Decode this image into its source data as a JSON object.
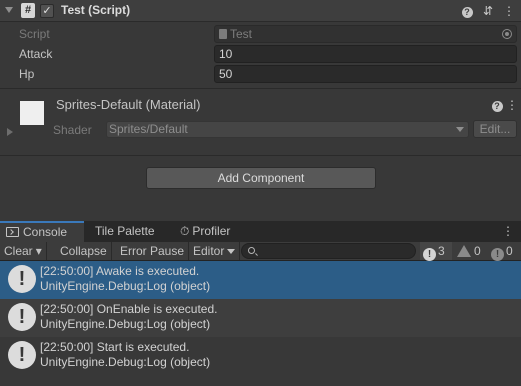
{
  "inspector": {
    "component": {
      "title": "Test (Script)",
      "script_icon_glyph": "#",
      "enabled_glyph": "✓",
      "icons": [
        "help-icon",
        "preset-icon",
        "more-icon"
      ]
    },
    "properties": [
      {
        "label": "Script",
        "value": "Test",
        "disabled": true
      },
      {
        "label": "Attack",
        "value": "10",
        "disabled": false
      },
      {
        "label": "Hp",
        "value": "50",
        "disabled": false
      }
    ],
    "material": {
      "title": "Sprites-Default (Material)",
      "shader_label": "Shader",
      "shader_value": "Sprites/Default",
      "edit_label": "Edit..."
    },
    "add_component_label": "Add Component"
  },
  "console": {
    "tabs": [
      {
        "label": "Console",
        "active": true
      },
      {
        "label": "Tile Palette",
        "active": false
      },
      {
        "label": "Profiler",
        "active": false
      }
    ],
    "toolbar": {
      "clear_label": "Clear",
      "dropdown_arrow": "▾",
      "collapse_label": "Collapse",
      "error_pause_label": "Error Pause",
      "editor_label": "Editor",
      "search_placeholder": "",
      "error_count": "3",
      "warning_count": "0",
      "info_count": "0"
    },
    "entries": [
      {
        "time_message": "[22:50:00] Awake is executed.",
        "source": "UnityEngine.Debug:Log (object)",
        "selected": true
      },
      {
        "time_message": "[22:50:00] OnEnable is executed.",
        "source": "UnityEngine.Debug:Log (object)",
        "selected": false
      },
      {
        "time_message": "[22:50:00] Start is executed.",
        "source": "UnityEngine.Debug:Log (object)",
        "selected": false
      }
    ]
  },
  "colors": {
    "panel": "#383838",
    "header": "#3e3e3e",
    "selection": "#2c5d87",
    "tab_accent": "#3a79bb",
    "field": "#2a2a2a"
  }
}
